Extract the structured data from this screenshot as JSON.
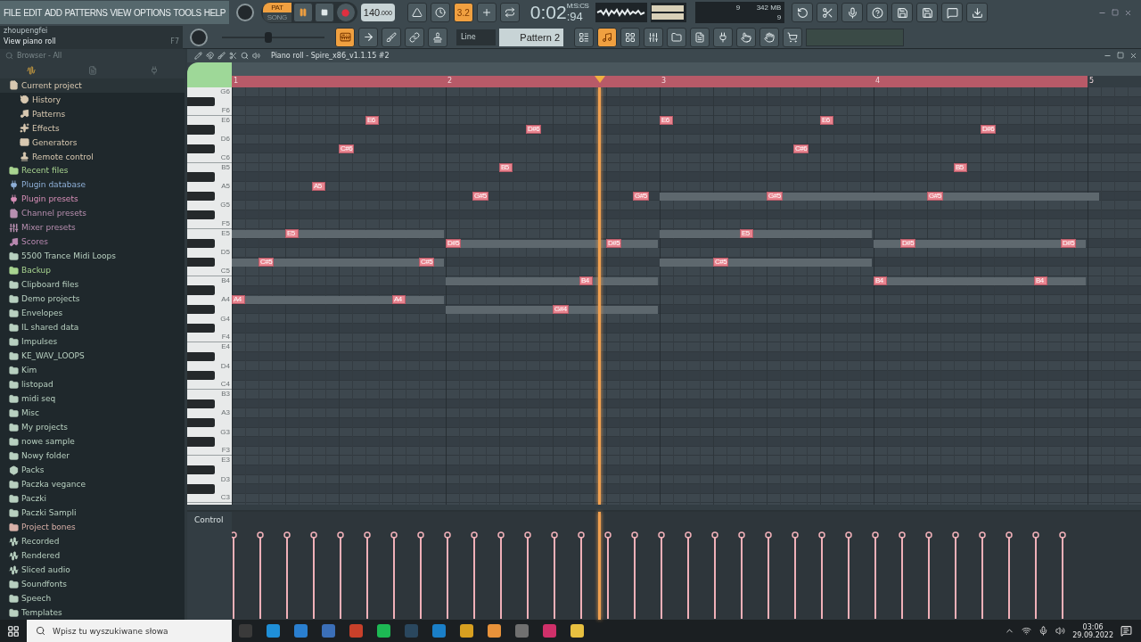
{
  "menu": [
    "FILE",
    "EDIT",
    "ADD",
    "PATTERNS",
    "VIEW",
    "OPTIONS",
    "TOOLS",
    "HELP"
  ],
  "transport": {
    "pat": "PAT",
    "song": "SONG",
    "pat_selected": true,
    "tempo": "140",
    "tempo_decimals": ".000",
    "time": "0:02",
    "time_cs": ":94",
    "time_label": "M:S:CS"
  },
  "master_volume": {
    "level": 0.45
  },
  "hint": {
    "user": "zhoupengfei",
    "text": "View piano roll",
    "shortcut": "F7"
  },
  "top_buttons": [
    {
      "kind": "metronome",
      "on": false
    },
    {
      "kind": "wait",
      "on": false
    },
    {
      "label": "3.2",
      "on": true
    },
    {
      "kind": "step",
      "on": false
    },
    {
      "kind": "loop-record",
      "on": false
    }
  ],
  "monitor": {
    "cpu": "9",
    "memory": "342 MB",
    "polyphony": "9"
  },
  "right_buttons": [
    {
      "kind": "undo"
    },
    {
      "kind": "cut"
    },
    {
      "kind": "mic"
    },
    {
      "kind": "help"
    },
    {
      "kind": "save"
    },
    {
      "kind": "save-split"
    },
    {
      "kind": "chat"
    },
    {
      "kind": "download"
    }
  ],
  "tool_buttons": [
    {
      "kind": "piano",
      "on": true
    },
    {
      "kind": "arrow",
      "on": false
    },
    {
      "kind": "brush",
      "on": false
    },
    {
      "kind": "link",
      "on": false
    },
    {
      "kind": "stamp",
      "on": false
    }
  ],
  "snap": "Line",
  "pattern": "Pattern 2",
  "window_buttons": [
    {
      "kind": "playlist",
      "on": false
    },
    {
      "kind": "piano-roll",
      "on": true
    },
    {
      "kind": "channels",
      "on": false
    },
    {
      "kind": "mixer",
      "on": false
    },
    {
      "kind": "browser",
      "on": false
    },
    {
      "kind": "file",
      "on": false
    },
    {
      "kind": "plugin",
      "on": false
    },
    {
      "kind": "touch",
      "on": false
    },
    {
      "kind": "hand",
      "on": false
    },
    {
      "kind": "cart",
      "on": false
    }
  ],
  "browser": {
    "path": "Browser - All",
    "items": [
      {
        "label": "Current project",
        "kind": "project",
        "color": "#d8c8b0",
        "expanded": true,
        "children": [
          {
            "label": "History",
            "kind": "history",
            "color": "#d8c8b0"
          },
          {
            "label": "Patterns",
            "kind": "note",
            "color": "#d8c8b0"
          },
          {
            "label": "Effects",
            "kind": "effect",
            "color": "#d8c8b0"
          },
          {
            "label": "Generators",
            "kind": "piano",
            "color": "#d8c8b0"
          },
          {
            "label": "Remote control",
            "kind": "remote",
            "color": "#d8c8b0"
          }
        ]
      },
      {
        "label": "Recent files",
        "kind": "folder",
        "color": "#a8d490"
      },
      {
        "label": "Plugin database",
        "kind": "plugin",
        "color": "#8fb0d8"
      },
      {
        "label": "Plugin presets",
        "kind": "plugin",
        "color": "#d88fb8"
      },
      {
        "label": "Channel presets",
        "kind": "preset",
        "color": "#b88fb0"
      },
      {
        "label": "Mixer presets",
        "kind": "mixer",
        "color": "#b88fb0"
      },
      {
        "label": "Scores",
        "kind": "note",
        "color": "#b888b0"
      },
      {
        "label": "5500 Trance Midi Loops",
        "kind": "folder",
        "color": "#b8d0c0"
      },
      {
        "label": "Backup",
        "kind": "folder",
        "color": "#a8d490"
      },
      {
        "label": "Clipboard files",
        "kind": "folder",
        "color": "#b8d0c0"
      },
      {
        "label": "Demo projects",
        "kind": "folder",
        "color": "#b8d0c0"
      },
      {
        "label": "Envelopes",
        "kind": "folder",
        "color": "#b8d0c0"
      },
      {
        "label": "IL shared data",
        "kind": "folder",
        "color": "#b8d0c0"
      },
      {
        "label": "Impulses",
        "kind": "folder",
        "color": "#b8d0c0"
      },
      {
        "label": "KE_WAV_LOOPS",
        "kind": "folder",
        "color": "#b8d0c0"
      },
      {
        "label": "Kim",
        "kind": "folder",
        "color": "#b8d0c0"
      },
      {
        "label": "listopad",
        "kind": "folder",
        "color": "#b8d0c0"
      },
      {
        "label": "midi seq",
        "kind": "folder",
        "color": "#b8d0c0"
      },
      {
        "label": "Misc",
        "kind": "folder",
        "color": "#b8d0c0"
      },
      {
        "label": "My projects",
        "kind": "folder",
        "color": "#b8d0c0"
      },
      {
        "label": "nowe sample",
        "kind": "folder",
        "color": "#b8d0c0"
      },
      {
        "label": "Nowy folder",
        "kind": "folder",
        "color": "#b8d0c0"
      },
      {
        "label": "Packs",
        "kind": "pack",
        "color": "#b8d0c0"
      },
      {
        "label": "Paczka vegance",
        "kind": "folder",
        "color": "#b8d0c0"
      },
      {
        "label": "Paczki",
        "kind": "folder",
        "color": "#b8d0c0"
      },
      {
        "label": "Paczki Sampli",
        "kind": "folder",
        "color": "#b8d0c0"
      },
      {
        "label": "Project bones",
        "kind": "folder",
        "color": "#d8b0a8"
      },
      {
        "label": "Recorded",
        "kind": "wave",
        "color": "#b8d0c0"
      },
      {
        "label": "Rendered",
        "kind": "wave",
        "color": "#b8d0c0"
      },
      {
        "label": "Sliced audio",
        "kind": "wave",
        "color": "#b8d0c0"
      },
      {
        "label": "Soundfonts",
        "kind": "folder",
        "color": "#b8d0c0"
      },
      {
        "label": "Speech",
        "kind": "folder",
        "color": "#b8d0c0"
      },
      {
        "label": "Templates",
        "kind": "folder",
        "color": "#b8d0c0"
      }
    ]
  },
  "piano_roll": {
    "title": "Piano roll - Spire_x86_v1.1.15 #2",
    "bars": [
      "1",
      "2",
      "3",
      "4",
      "5"
    ],
    "keys": [
      "G6",
      "F6",
      "E6",
      "D6",
      "C6",
      "B5",
      "A5",
      "G5",
      "F5",
      "E5",
      "D5",
      "C5",
      "B4",
      "A4",
      "G4",
      "F4",
      "E4",
      "D4",
      "C4",
      "B3",
      "A3",
      "G3",
      "F3",
      "E3",
      "D3",
      "C3"
    ],
    "notes": [
      {
        "label": "A4"
      },
      {
        "label": "C#5"
      },
      {
        "label": "E5"
      },
      {
        "label": "A5"
      },
      {
        "label": "C#6"
      },
      {
        "label": "E6"
      },
      {
        "label": "A4"
      },
      {
        "label": "C#5"
      },
      {
        "label": "D#5"
      },
      {
        "label": "G#5"
      },
      {
        "label": "B5"
      },
      {
        "label": "D#6"
      },
      {
        "label": "G#4"
      },
      {
        "label": "B4"
      },
      {
        "label": "D#5"
      },
      {
        "label": "G#5"
      },
      {
        "label": "E6"
      },
      {
        "label": "C#5"
      },
      {
        "label": "E5"
      },
      {
        "label": "G#5"
      },
      {
        "label": "C#6"
      },
      {
        "label": "E6"
      },
      {
        "label": "B4"
      },
      {
        "label": "D#5"
      },
      {
        "label": "G#5"
      },
      {
        "label": "B5"
      },
      {
        "label": "D#6"
      },
      {
        "label": "B4"
      },
      {
        "label": "D#5"
      }
    ],
    "control": "Control"
  },
  "taskbar": {
    "search_placeholder": "Wpisz tu wyszukiwane słowa",
    "apps": [
      {
        "color": "#3a3a3a"
      },
      {
        "color": "#1f8fd8"
      },
      {
        "color": "#2a7fd0"
      },
      {
        "color": "#3b6fb8"
      },
      {
        "color": "#c8402a"
      },
      {
        "color": "#1db954"
      },
      {
        "color": "#2a475e"
      },
      {
        "color": "#1a7fc8"
      },
      {
        "color": "#d8a020"
      },
      {
        "color": "#e8923a"
      },
      {
        "color": "#707070"
      },
      {
        "color": "#d0306a"
      },
      {
        "color": "#e8c040"
      }
    ],
    "time": "03:06",
    "date": "29.09.2022"
  }
}
